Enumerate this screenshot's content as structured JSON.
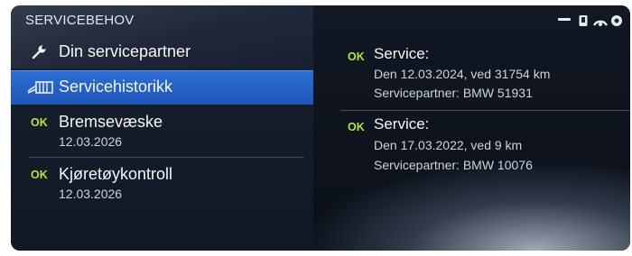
{
  "left_pane": {
    "title": "SERVICEBEHOV",
    "items": [
      {
        "label": "Din servicepartner",
        "icon": "wrench-icon"
      },
      {
        "label": "Servicehistorikk",
        "icon": "service-book-icon",
        "selected": true
      },
      {
        "status": "OK",
        "label": "Bremsevæske",
        "date": "12.03.2026"
      },
      {
        "status": "OK",
        "label": "Kjøretøykontroll",
        "date": "12.03.2026"
      }
    ]
  },
  "right_pane": {
    "entries": [
      {
        "status": "OK",
        "title": "Service:",
        "line1": "Den 12.03.2024, ved 31754 km",
        "line2": "Servicepartner: BMW 51931"
      },
      {
        "status": "OK",
        "title": "Service:",
        "line1": "Den 17.03.2022, ved 9 km",
        "line2": "Servicepartner: BMW 10076"
      }
    ]
  },
  "status_bar": {
    "icons": [
      "minus-icon",
      "phone-icon",
      "signal-icon",
      "settings-icon"
    ]
  },
  "colors": {
    "selection": "#2e6fd6",
    "ok": "#b9e23a",
    "background": "#0d121c"
  }
}
